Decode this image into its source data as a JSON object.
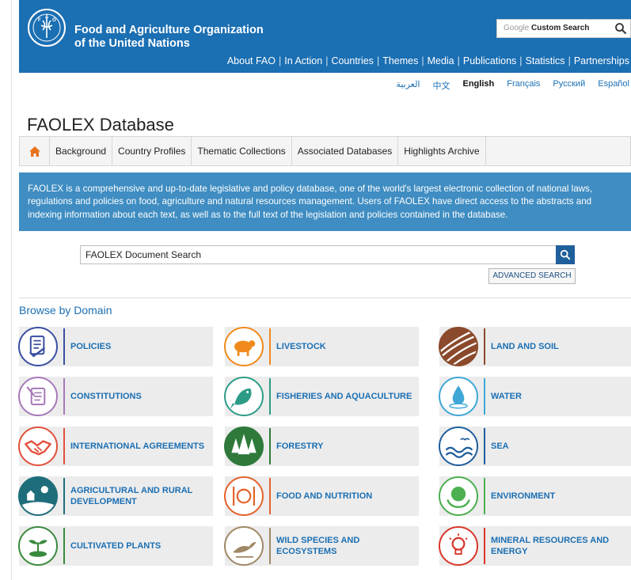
{
  "header": {
    "org_line1": "Food and Agriculture Organization",
    "org_line2": "of the United Nations",
    "logo_text": "FIAT PANIS",
    "google_search": {
      "prefix": "Google",
      "label": "Custom Search"
    },
    "nav": [
      "About FAO",
      "In Action",
      "Countries",
      "Themes",
      "Media",
      "Publications",
      "Statistics",
      "Partnerships"
    ]
  },
  "languages": [
    {
      "label": "العربية",
      "active": false
    },
    {
      "label": "中文",
      "active": false
    },
    {
      "label": "English",
      "active": true
    },
    {
      "label": "Français",
      "active": false
    },
    {
      "label": "Русский",
      "active": false
    },
    {
      "label": "Español",
      "active": false
    }
  ],
  "page_title": "FAOLEX Database",
  "tabs": [
    "Background",
    "Country Profiles",
    "Thematic Collections",
    "Associated Databases",
    "Highlights Archive"
  ],
  "intro_text": "FAOLEX is a comprehensive and up-to-date legislative and policy database, one of the world's largest electronic collection of national laws, regulations and policies on food, agriculture and natural resources management. Users of FAOLEX have direct access to the abstracts and indexing information about each text, as well as to the full text of the legislation and policies contained in the database.",
  "search": {
    "placeholder": "FAOLEX Document Search",
    "advanced_label": "ADVANCED SEARCH"
  },
  "browse_title": "Browse by Domain",
  "colors": {
    "header_blue": "#1b6fb3",
    "intro_blue": "#3f8dc2",
    "link_blue": "#1b6fb3"
  },
  "domains": [
    {
      "label": "POLICIES",
      "color": "#3a4fa0",
      "icon": "policy-document-icon"
    },
    {
      "label": "LIVESTOCK",
      "color": "#f08a1c",
      "icon": "sheep-icon"
    },
    {
      "label": "LAND AND SOIL",
      "color": "#8b4a2b",
      "icon": "field-furrows-icon"
    },
    {
      "label": "CONSTITUTIONS",
      "color": "#a679b8",
      "icon": "scroll-quill-icon"
    },
    {
      "label": "FISHERIES AND AQUACULTURE",
      "color": "#2d9c87",
      "icon": "fish-icon"
    },
    {
      "label": "WATER",
      "color": "#3fa7d6",
      "icon": "water-drop-icon"
    },
    {
      "label": "INTERNATIONAL AGREEMENTS",
      "color": "#e2503c",
      "icon": "handshake-icon"
    },
    {
      "label": "FORESTRY",
      "color": "#2f7a3b",
      "icon": "trees-icon"
    },
    {
      "label": "SEA",
      "color": "#1f5e9e",
      "icon": "waves-birds-icon"
    },
    {
      "label": "AGRICULTURAL AND RURAL DEVELOPMENT",
      "color": "#1e6d7a",
      "icon": "rural-landscape-icon"
    },
    {
      "label": "FOOD AND NUTRITION",
      "color": "#e5622a",
      "icon": "plate-cutlery-icon"
    },
    {
      "label": "ENVIRONMENT",
      "color": "#4caf50",
      "icon": "globe-hands-icon"
    },
    {
      "label": "CULTIVATED PLANTS",
      "color": "#3a8a3e",
      "icon": "seedling-icon"
    },
    {
      "label": "WILD SPECIES AND ECOSYSTEMS",
      "color": "#a08866",
      "icon": "wild-bird-icon"
    },
    {
      "label": "MINERAL RESOURCES AND ENERGY",
      "color": "#d9362a",
      "icon": "lightbulb-icon"
    }
  ]
}
